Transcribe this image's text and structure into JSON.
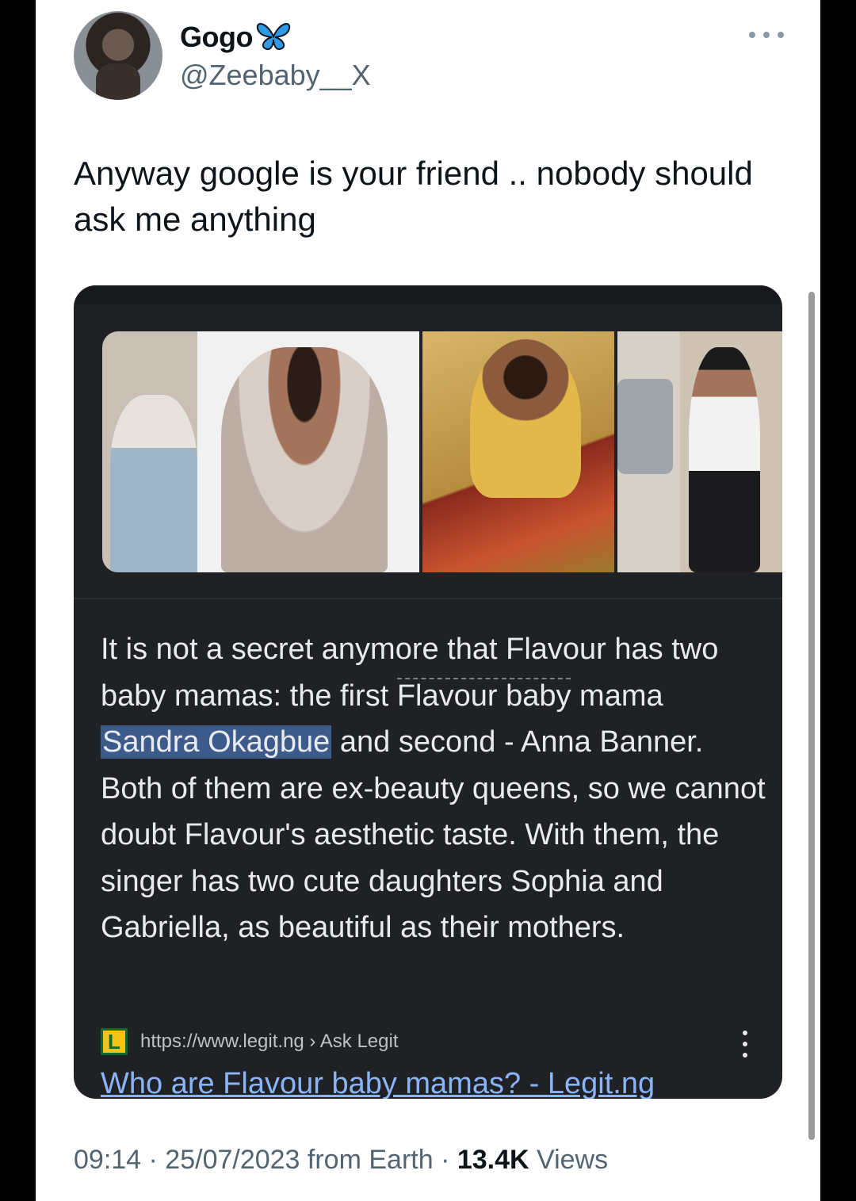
{
  "tweet": {
    "display_name": "Gogo",
    "handle": "@Zeebaby__X",
    "text": "Anyway google is your friend .. nobody should ask me anything",
    "icons": {
      "verified_emoji": "butterfly-icon",
      "more": "more-icon"
    }
  },
  "card": {
    "snippet_parts": {
      "p1": "It is not a secret anymore that Flavour has two baby mamas: the first ",
      "p2": "Flavour baby",
      "p3": " mama ",
      "highlight": "Sandra Okagbue",
      "p4": " and second - Anna Banner. Both of them are ex-beauty queens, so we cannot doubt Flavour's aesthetic taste. With them, the singer has two cute daughters Sophia and Gabriella, as beautiful as their mothers."
    },
    "source_icon_letter": "L",
    "source_text": "https://www.legit.ng › Ask Legit",
    "result_title": "Who are Flavour baby mamas? - Legit.ng"
  },
  "meta": {
    "time_date": "09:14 · 25/07/2023 from Earth · ",
    "views_count": "13.4K",
    "views_label": " Views"
  }
}
